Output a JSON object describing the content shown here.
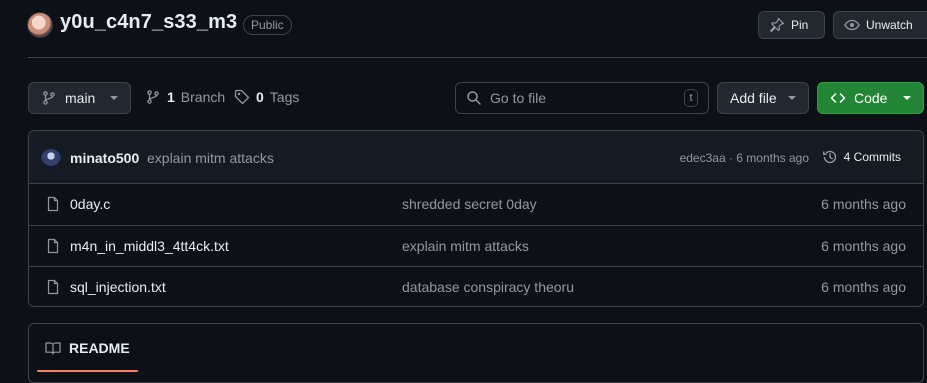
{
  "repo": {
    "name": "y0u_c4n7_s33_m3",
    "visibility": "Public"
  },
  "header_actions": {
    "pin_label": "Pin",
    "unwatch_label": "Unwatch"
  },
  "toolbar": {
    "branch": "main",
    "branch_count": "1",
    "branch_label": "Branch",
    "tag_count": "0",
    "tag_label": "Tags",
    "search_placeholder": "Go to file",
    "search_shortcut": "t",
    "add_file_label": "Add file",
    "code_label": "Code"
  },
  "latest_commit": {
    "author": "minato500",
    "message": "explain mitm attacks",
    "hash_time": "edec3aa · 6 months ago",
    "commits_label": "4 Commits"
  },
  "files": [
    {
      "name": "0day.c",
      "commit": "shredded secret 0day",
      "time": "6 months ago",
      "icon": "file-icon"
    },
    {
      "name": "m4n_in_middl3_4tt4ck.txt",
      "commit": "explain mitm attacks",
      "time": "6 months ago",
      "icon": "file-icon"
    },
    {
      "name": "sql_injection.txt",
      "commit": "database conspiracy theoru",
      "time": "6 months ago",
      "icon": "file-icon"
    }
  ],
  "readme": {
    "tab_label": "README"
  },
  "colors": {
    "background": "#0d1117",
    "border": "#3d444d",
    "code_button": "#238636",
    "muted_text": "#9198a1",
    "readme_underline": "#f78166"
  }
}
